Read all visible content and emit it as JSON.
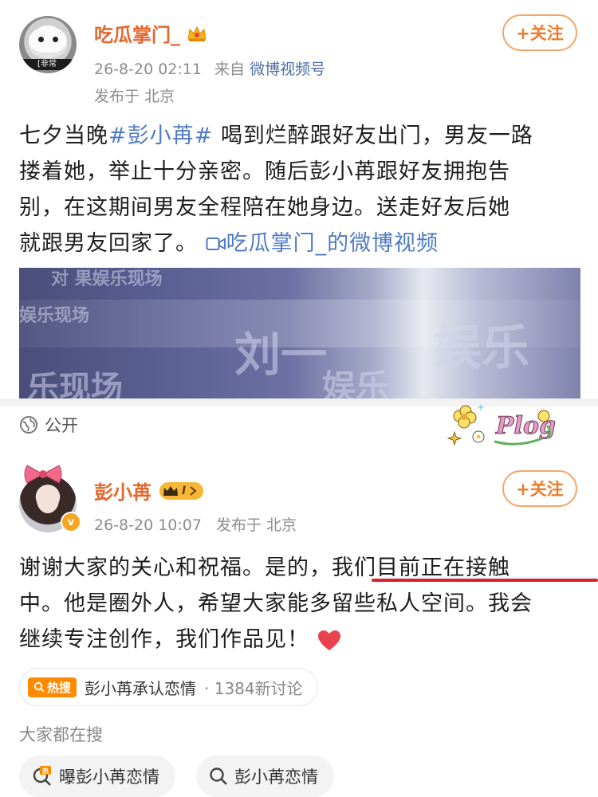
{
  "post1": {
    "author": "吃瓜掌门_",
    "avatar_tag": "[非常",
    "time": "26-8-20 02:11",
    "source_prefix": "来自",
    "source": "微博视频号",
    "location": "发布于 北京",
    "follow_label": "+关注",
    "text_lines": [
      {
        "before": "七夕当晚",
        "tag": "#彭小苒#",
        "after": " 喝到烂醉跟好友出门，男友一路"
      },
      "搂着她，举止十分亲密。随后彭小苒跟好友拥抱告",
      "别，在这期间男友全程陪在她身边。送走好友后她",
      {
        "before": "就跟男友回家了。 ",
        "link": "吃瓜掌门_的微博视频"
      }
    ],
    "video_watermarks": [
      "对  果娱乐现场",
      "娱乐现场",
      "刘一",
      "娱乐",
      "乐现场",
      "娱乐"
    ]
  },
  "public_label": "公开",
  "sticker_text": "Plog",
  "post2": {
    "author": "彭小苒",
    "level_badge": "I",
    "verify_badge": "v",
    "time": "26-8-20 10:07",
    "location": "发布于 北京",
    "follow_label": "+关注",
    "text_lines": [
      {
        "before": "谢谢大家的关心和祝福。是的，",
        "highlight": "我们目前正在接触"
      },
      "中。他是圈外人，希望大家能多留些私人空间。我会",
      "继续专注创作，我们作品见！"
    ]
  },
  "hot_search": {
    "badge": "热搜",
    "topic": "彭小苒承认恋情",
    "count": "· 1384新讨论"
  },
  "everyone_searching": {
    "title": "大家都在搜",
    "chips": [
      {
        "icon": "hot-search-icon",
        "label": "曝彭小苒恋情"
      },
      {
        "icon": "search-icon",
        "label": "彭小苒恋情"
      }
    ]
  },
  "colors": {
    "brand_orange": "#e8662c",
    "link_blue": "#4f7ac4",
    "underline_red": "#d8212b",
    "hot_orange": "#ff8a00"
  }
}
